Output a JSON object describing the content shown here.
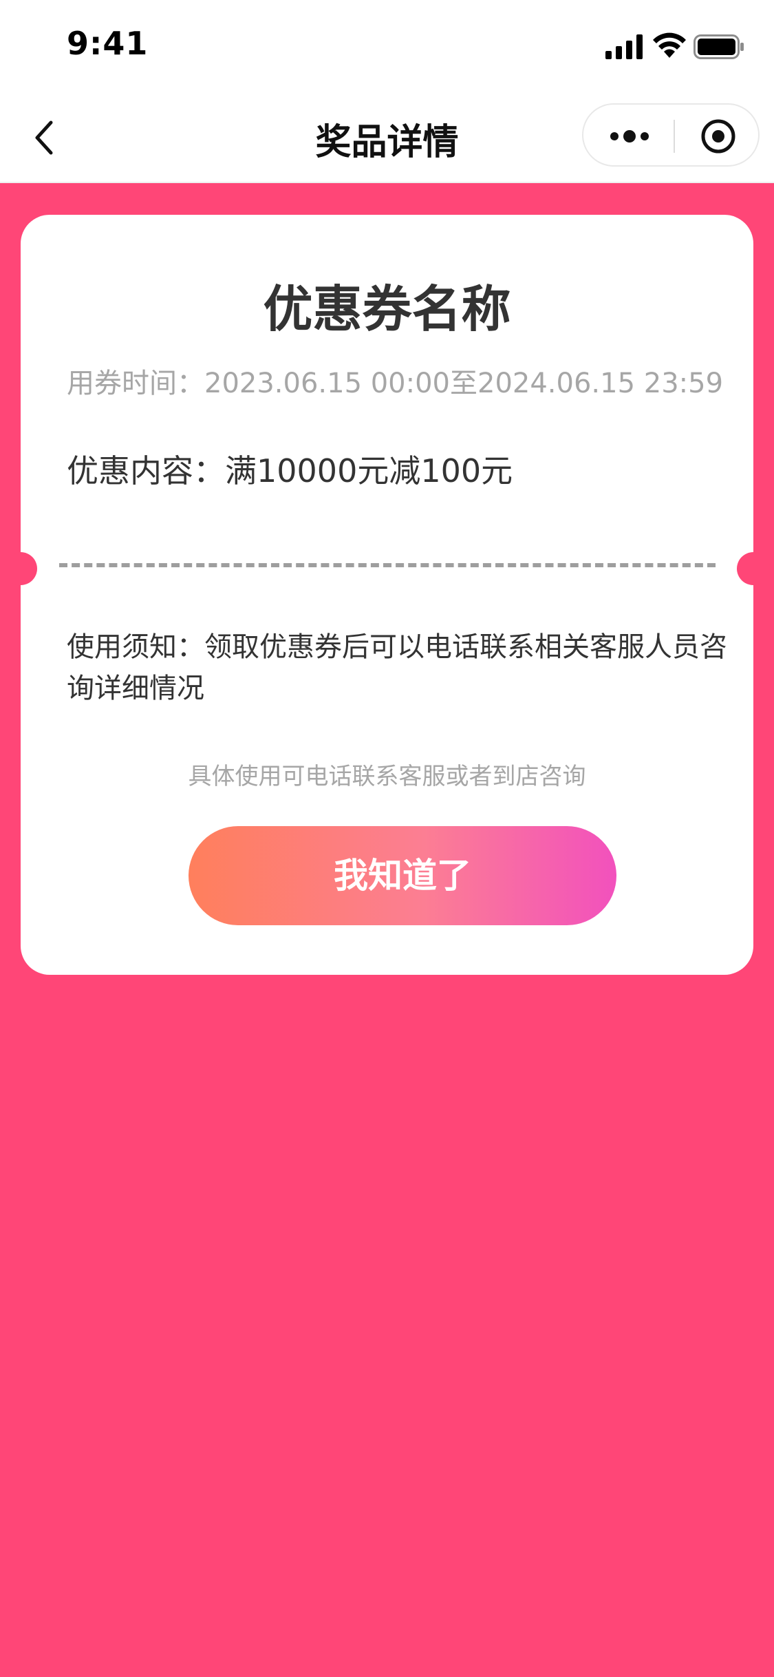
{
  "status_bar": {
    "time": "9:41",
    "icons": [
      "cellular-signal-icon",
      "wifi-icon",
      "battery-icon"
    ]
  },
  "nav": {
    "title": "奖品详情",
    "back_icon": "chevron-left-icon",
    "more_icon": "more-dots-icon",
    "close_icon": "target-circle-icon"
  },
  "coupon": {
    "name": "优惠券名称",
    "validity": "用券时间：2023.06.15 00:00至2024.06.15 23:59",
    "discount": "优惠内容：满10000元减100元",
    "notice": "使用须知：领取优惠券后可以电话联系相关客服人员咨询详细情况",
    "hint": "具体使用可电话联系客服或者到店咨询",
    "button_label": "我知道了"
  },
  "colors": {
    "background": "#ff4677",
    "card": "#ffffff",
    "button_gradient_start": "#ff7f5c",
    "button_gradient_end": "#f251bd",
    "muted_text": "#a6a6a6"
  }
}
